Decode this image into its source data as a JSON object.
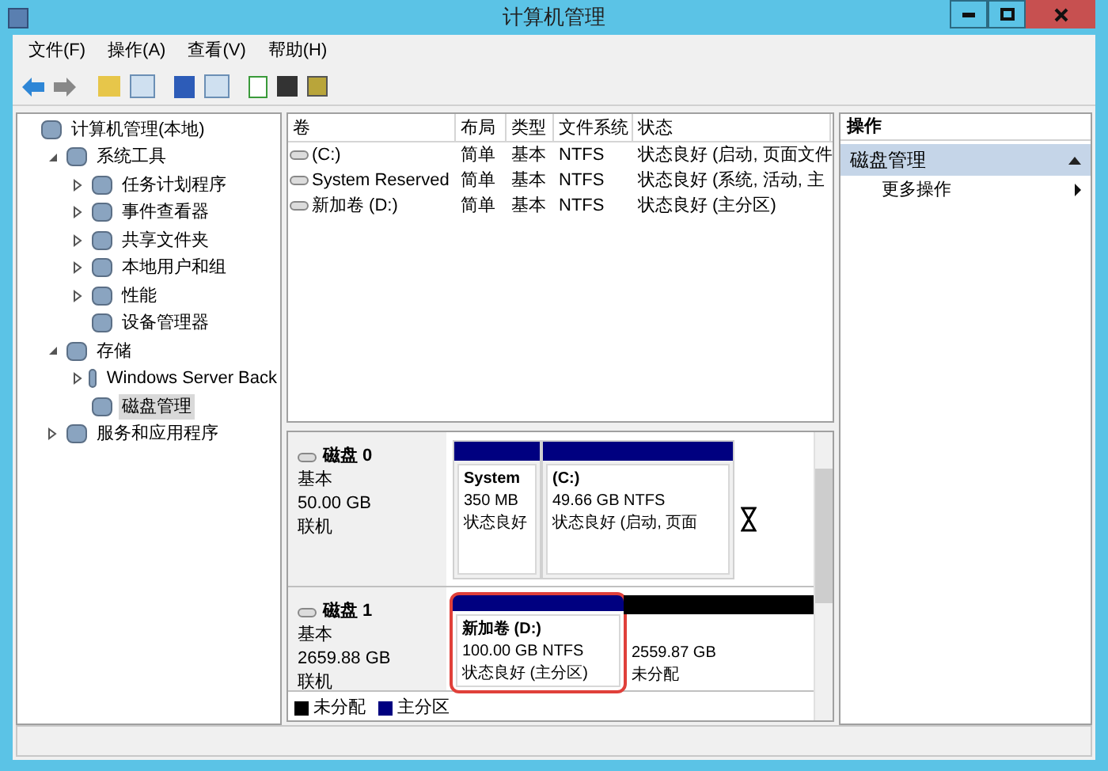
{
  "window": {
    "title": "计算机管理"
  },
  "menu": [
    {
      "label": "文件(F)"
    },
    {
      "label": "操作(A)"
    },
    {
      "label": "查看(V)"
    },
    {
      "label": "帮助(H)"
    }
  ],
  "tree": [
    {
      "label": "计算机管理(本地)",
      "selected": false,
      "children": [
        {
          "label": "系统工具",
          "expanded": true,
          "selected": false,
          "children": [
            {
              "label": "任务计划程序",
              "expanded": false,
              "selected": false
            },
            {
              "label": "事件查看器",
              "expanded": false,
              "selected": false
            },
            {
              "label": "共享文件夹",
              "expanded": false,
              "selected": false
            },
            {
              "label": "本地用户和组",
              "expanded": false,
              "selected": false
            },
            {
              "label": "性能",
              "expanded": false,
              "selected": false
            },
            {
              "label": "设备管理器",
              "selected": false
            }
          ]
        },
        {
          "label": "存储",
          "expanded": true,
          "selected": false,
          "children": [
            {
              "label": "Windows Server Back",
              "expanded": false,
              "selected": false
            },
            {
              "label": "磁盘管理",
              "selected": true
            }
          ]
        },
        {
          "label": "服务和应用程序",
          "expanded": false,
          "selected": false
        }
      ]
    }
  ],
  "volumes": {
    "columns": [
      "卷",
      "布局",
      "类型",
      "文件系统",
      "状态"
    ],
    "rows": [
      [
        "(C:)",
        "简单",
        "基本",
        "NTFS",
        "状态良好 (启动, 页面文件"
      ],
      [
        "System Reserved",
        "简单",
        "基本",
        "NTFS",
        "状态良好 (系统, 活动, 主"
      ],
      [
        "新加卷 (D:)",
        "简单",
        "基本",
        "NTFS",
        "状态良好 (主分区)"
      ]
    ]
  },
  "disks": [
    {
      "name": "磁盘 0",
      "type": "基本",
      "size": "50.00 GB",
      "status": "联机",
      "partitions": [
        {
          "title": "System",
          "size": "350 MB",
          "status": "状态良好",
          "color": "#000080",
          "highlighted": false
        },
        {
          "title": "(C:)",
          "size": "49.66 GB NTFS",
          "status": "状态良好 (启动, 页面",
          "color": "#000080",
          "highlighted": false
        }
      ]
    },
    {
      "name": "磁盘 1",
      "type": "基本",
      "size": "2659.88 GB",
      "status": "联机",
      "partitions": [
        {
          "title": "新加卷  (D:)",
          "size": "100.00 GB NTFS",
          "status": "状态良好 (主分区)",
          "color": "#000080",
          "highlighted": true
        },
        {
          "size": "2559.87 GB",
          "status": "未分配",
          "color": "#000000",
          "highlighted": false
        }
      ]
    }
  ],
  "legend": [
    {
      "label": "未分配",
      "color": "#000000"
    },
    {
      "label": "主分区",
      "color": "#000080"
    }
  ],
  "actions": {
    "header": "操作",
    "section": {
      "label": "磁盘管理",
      "expanded": true
    },
    "items": [
      {
        "label": "更多操作"
      }
    ]
  }
}
